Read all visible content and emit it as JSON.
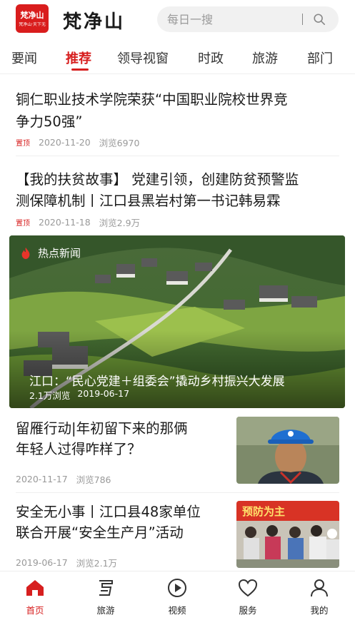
{
  "header": {
    "logo_glyph": "梵净山",
    "logo_subtext": "梵净山·天下无",
    "app_title": "梵净山",
    "search_placeholder": "每日一搜",
    "search_icon": "search-icon"
  },
  "tabs": [
    {
      "label": "要闻"
    },
    {
      "label": "推荐",
      "active": true
    },
    {
      "label": "领导视窗"
    },
    {
      "label": "时政"
    },
    {
      "label": "旅游"
    },
    {
      "label": "部门"
    }
  ],
  "news": [
    {
      "title": "铜仁职业技术学院荣获“中国职业院校世界竞争力50强”",
      "line1": "铜仁职业技术学院荣获“中国职业院校世界竞",
      "line2": "争力50强”",
      "pin": "置顶",
      "date": "2020-11-20",
      "views": "浏览6970"
    },
    {
      "line1": "【我的扶贫故事】 党建引领，创建防贫预警监",
      "line2": "测保障机制丨江口县黑岩村第一书记韩易霖",
      "pin": "置顶",
      "date": "2020-11-18",
      "views": "浏览2.9万"
    }
  ],
  "feature": {
    "badge": "热点新闻",
    "caption": "江口：“民心党建＋组委会”撬动乡村振兴大发展",
    "views": "2.1万浏览",
    "date": "2019-06-17"
  },
  "thumb_news": [
    {
      "line1": "留雁行动|年初留下来的那俩",
      "line2": "年轻人过得咋样了？",
      "date": "2020-11-17",
      "views": "浏览786"
    },
    {
      "line1": "安全无小事丨江口县48家单位",
      "line2": "联合开展“安全生产月”活动",
      "date": "2019-06-17",
      "views": "浏览2.1万",
      "banner_text": "预防为主"
    }
  ],
  "bottom_nav": [
    {
      "label": "首页",
      "icon": "home-icon",
      "active": true
    },
    {
      "label": "旅游",
      "icon": "travel-icon"
    },
    {
      "label": "视频",
      "icon": "play-icon"
    },
    {
      "label": "服务",
      "icon": "heart-icon"
    },
    {
      "label": "我的",
      "icon": "user-icon"
    }
  ],
  "colors": {
    "accent": "#d71f1f",
    "meta_text": "#999999",
    "search_bg": "#f1f1f1"
  }
}
